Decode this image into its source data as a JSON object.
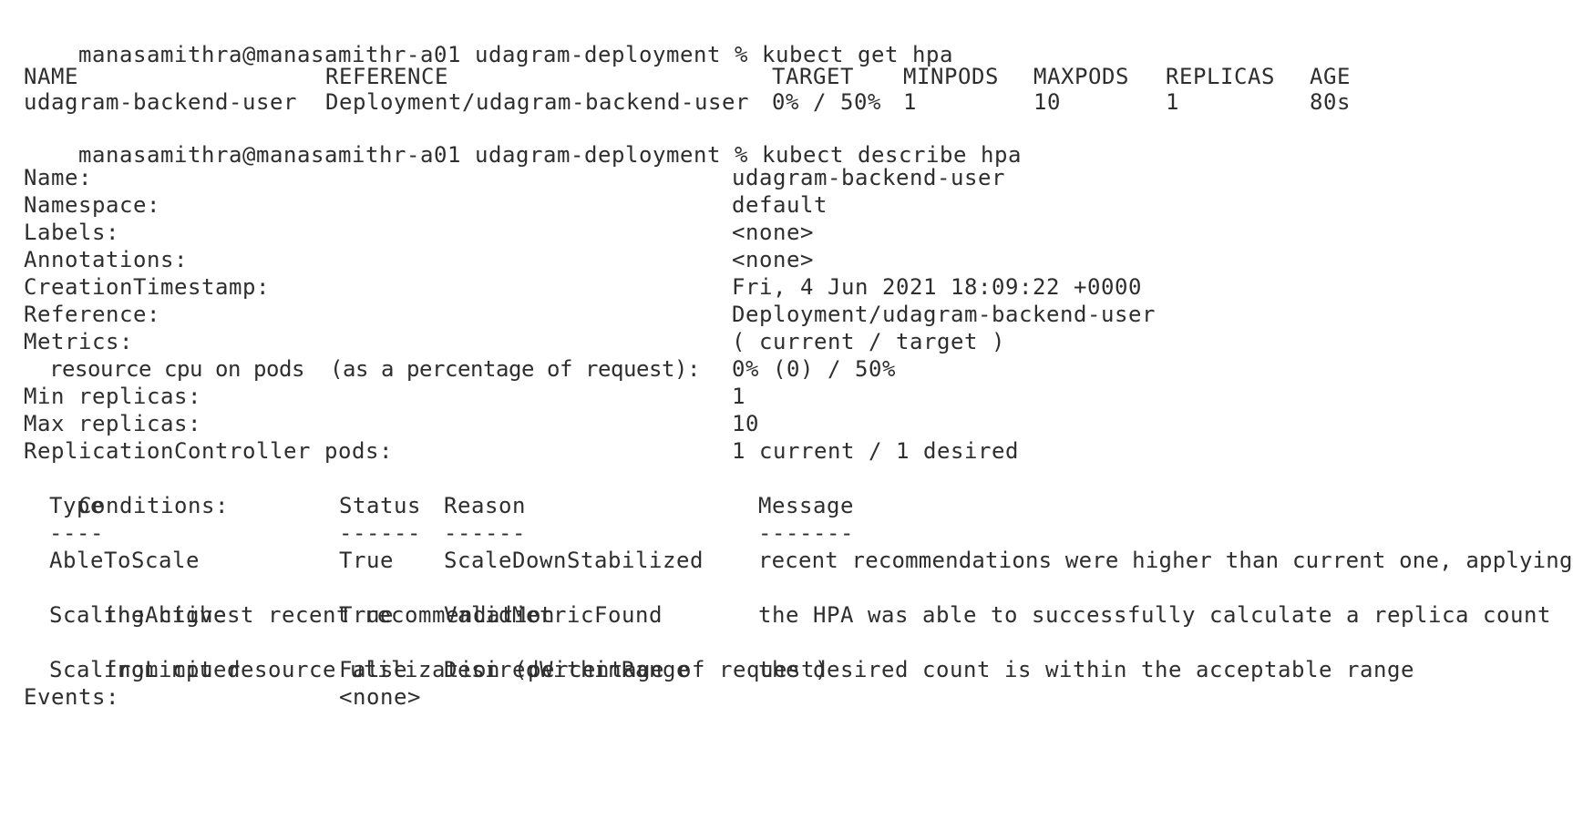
{
  "terminal": {
    "cmd1": {
      "prompt": "manasamithra@manasamithr-a01 udagram-deployment %",
      "command": "kubect get hpa"
    },
    "get_hpa": {
      "headers": [
        "NAME",
        "REFERENCE",
        "TARGET",
        "MINPODS",
        "MAXPODS",
        "REPLICAS",
        "AGE"
      ],
      "row": [
        "udagram-backend-user",
        "Deployment/udagram-backend-user",
        "0% / 50%",
        "1",
        "10",
        "1",
        "80s"
      ]
    },
    "cmd2": {
      "prompt": "manasamithra@manasamithr-a01 udagram-deployment %",
      "command": "kubect describe hpa"
    },
    "describe": {
      "name": {
        "label": "Name:",
        "value": "udagram-backend-user"
      },
      "namespace": {
        "label": "Namespace:",
        "value": "default"
      },
      "labels": {
        "label": "Labels:",
        "value": "<none>"
      },
      "annotations": {
        "label": "Annotations:",
        "value": "<none>"
      },
      "creation": {
        "label": "CreationTimestamp:",
        "value": "Fri, 4 Jun 2021 18:09:22 +0000"
      },
      "reference": {
        "label": "Reference:",
        "value": "Deployment/udagram-backend-user"
      },
      "metrics": {
        "label": "Metrics:",
        "value": "( current / target )"
      },
      "metric_cpu": {
        "label": "resource cpu on pods  (as a percentage of request):",
        "value": "0% (0) / 50%"
      },
      "min_replicas": {
        "label": "Min replicas:",
        "value": "1"
      },
      "max_replicas": {
        "label": "Max replicas:",
        "value": "10"
      },
      "rc_pods": {
        "label": "ReplicationController pods:",
        "value": "1 current / 1 desired"
      },
      "conditions_label": "Conditions:",
      "conditions_headers": {
        "type": "Type",
        "status": "Status",
        "reason": "Reason",
        "message": "Message"
      },
      "conditions_rules": {
        "type": "----",
        "status": "------",
        "reason": "------",
        "message": "-------"
      },
      "conditions": [
        {
          "type": "AbleToScale",
          "status": "True",
          "reason": "ScaleDownStabilized",
          "message": "recent recommendations were higher than current one, applying",
          "message_cont": "the highest recent recommendation"
        },
        {
          "type": "ScalingActive",
          "status": "True",
          "reason": "ValidMetricFound",
          "message": "the HPA was able to successfully calculate a replica count",
          "message_cont": "from cpu resource utilization (percentage of request)"
        },
        {
          "type": "ScalingLimited",
          "status": "False",
          "reason": "DesiredWithinRange",
          "message": "the desired count is within the acceptable range"
        }
      ],
      "events": {
        "label": "Events:",
        "value": "<none>"
      }
    }
  }
}
